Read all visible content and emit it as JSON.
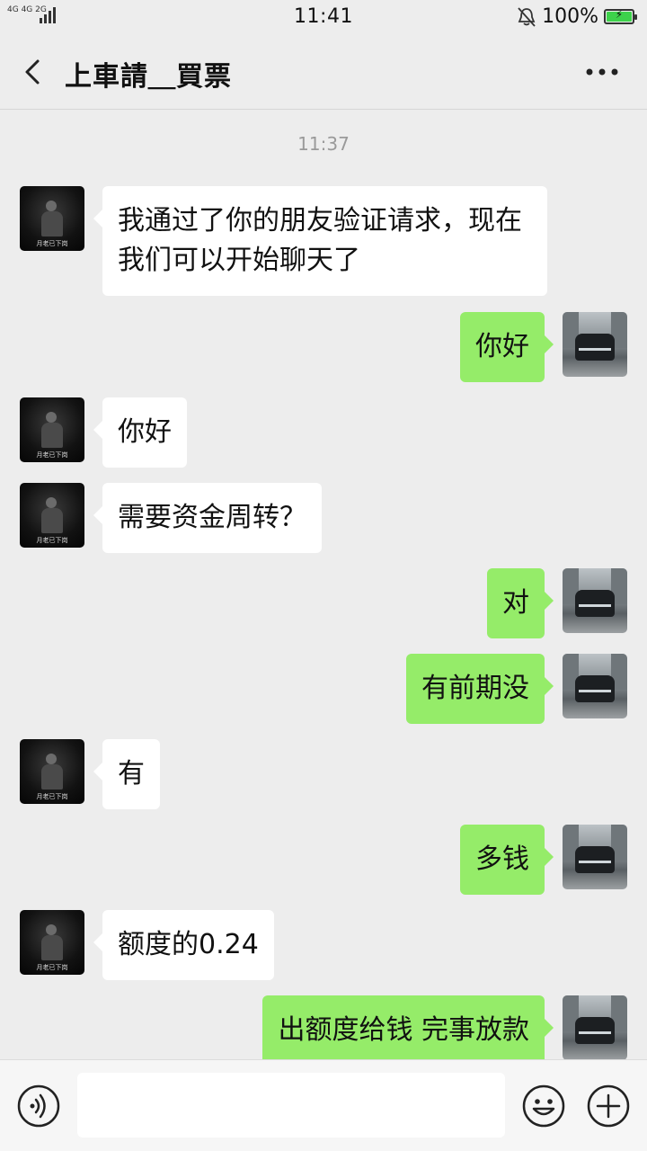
{
  "status_bar": {
    "network_1": "4G",
    "network_2": "4G",
    "network_3": "2G",
    "time": "11:41",
    "battery_text": "100%",
    "battery_level": 1.0,
    "battery_color": "#3dd24b",
    "icons": [
      "mute-bell-icon",
      "battery-charging-icon"
    ]
  },
  "header": {
    "title": "上車請＿買票",
    "back_icon": "chevron-left-icon",
    "more_icon": "more-dots-icon"
  },
  "chat": {
    "timestamp": "11:37",
    "messages": [
      {
        "side": "in",
        "text": "我通过了你的朋友验证请求，现在我们可以开始聊天了"
      },
      {
        "side": "out",
        "text": "你好"
      },
      {
        "side": "in",
        "text": "你好"
      },
      {
        "side": "in",
        "text": "需要资金周转？"
      },
      {
        "side": "out",
        "text": "对"
      },
      {
        "side": "out",
        "text": "有前期没"
      },
      {
        "side": "in",
        "text": "有"
      },
      {
        "side": "out",
        "text": "多钱"
      },
      {
        "side": "in",
        "text": "额度的0.24"
      },
      {
        "side": "out",
        "text": "出额度给钱 完事放款"
      }
    ],
    "contact_avatar_caption": "月老已下岗",
    "colors": {
      "incoming_bubble": "#ffffff",
      "outgoing_bubble": "#95ec69",
      "background": "#ededed"
    }
  },
  "input_bar": {
    "value": "",
    "icons": [
      "voice-icon",
      "emoji-icon",
      "plus-icon"
    ]
  }
}
